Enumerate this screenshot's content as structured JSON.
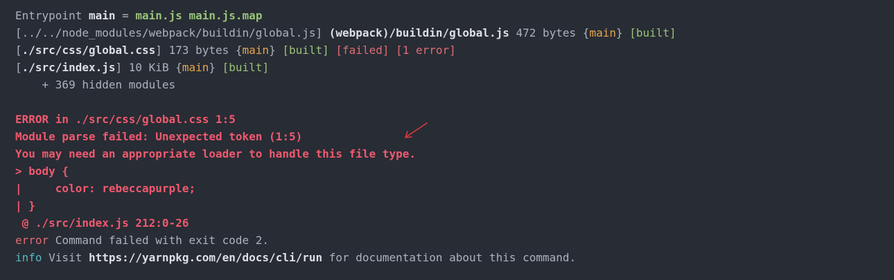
{
  "output": {
    "entrypoint": {
      "prefix": "Entrypoint ",
      "name": "main",
      "equals": " = ",
      "file1": "main.js",
      "space": " ",
      "file2": "main.js.map"
    },
    "module1": {
      "open": "[",
      "path": "../../node_modules/webpack/buildin/global.js",
      "close": "] ",
      "resolved": "(webpack)/buildin/global.js",
      "size": " 472 bytes {",
      "chunk": "main",
      "brace": "} ",
      "status": "[built]"
    },
    "module2": {
      "open": "[",
      "path": "./src/css/global.css",
      "close": "]",
      "size": " 173 bytes {",
      "chunk": "main",
      "brace": "} ",
      "status": "[built]",
      "sp1": " ",
      "failed": "[failed]",
      "sp2": " ",
      "errors": "[1 error]"
    },
    "module3": {
      "open": "[",
      "path": "./src/index.js",
      "close": "]",
      "size": " 10 KiB {",
      "chunk": "main",
      "brace": "} ",
      "status": "[built]"
    },
    "hidden": "    + 369 hidden modules",
    "error_block": {
      "line1": "ERROR in ./src/css/global.css 1:5",
      "line2": "Module parse failed: Unexpected token (1:5)",
      "line3": "You may need an appropriate loader to handle this file type.",
      "line4": "> body {",
      "line5": "|     color: rebeccapurple;",
      "line6": "| }",
      "line7": " @ ./src/index.js 212:0-26"
    },
    "error_line": {
      "tag": "error",
      "text": " Command failed with exit code 2."
    },
    "info_line": {
      "tag": "info",
      "text1": " Visit ",
      "url": "https://yarnpkg.com/en/docs/cli/run",
      "text2": " for documentation about this command."
    }
  },
  "colors": {
    "background": "#282c34",
    "text": "#abb2bf",
    "green": "#98c379",
    "yellow": "#e5a550",
    "red": "#e06c75",
    "error": "#ef596f",
    "info": "#56b6c2",
    "annotation_arrow": "#e0393e"
  },
  "annotation": {
    "icon": "red-arrow-icon"
  }
}
